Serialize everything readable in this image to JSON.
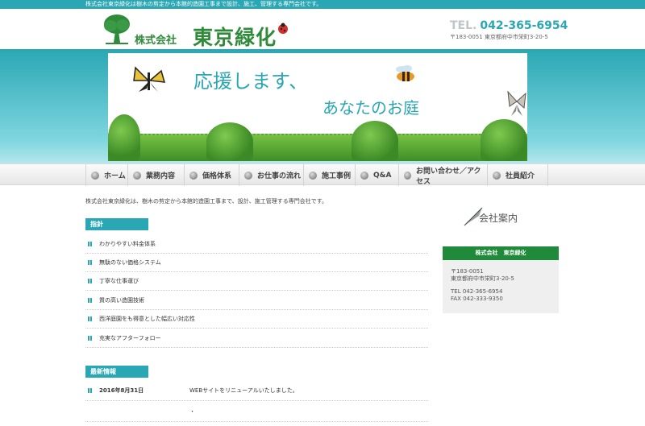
{
  "topbar": {
    "text": "株式会社東京緑化は樹木の剪定から本館的造園工事まで設計、施工、管理する専門会社です。"
  },
  "header": {
    "logo_small": "株式会社",
    "logo_big": "東京緑化",
    "tel_label": "TEL.",
    "tel": "042-365-6954",
    "address": "〒183-0051 東京都府中市栄町3-20-5"
  },
  "banner": {
    "line1": "応援します、",
    "line2": "あなたのお庭"
  },
  "nav": {
    "items": [
      {
        "label": "ホーム"
      },
      {
        "label": "業務内容"
      },
      {
        "label": "価格体系"
      },
      {
        "label": "お仕事の流れ"
      },
      {
        "label": "施工事例"
      },
      {
        "label": "Q&A"
      },
      {
        "label": "お問い合わせ／アクセス"
      },
      {
        "label": "社員紹介"
      }
    ]
  },
  "intro": "株式会社東京緑化は、樹木の剪定から本館的造園工事まで、設計、施工管理する専門会社です。",
  "policy": {
    "title": "指針",
    "items": [
      "わかりやすい料金体系",
      "無駄のない価格システム",
      "丁寧な仕事運び",
      "質の高い造園技術",
      "西洋庭園をも得意とした幅広い対応性",
      "充実なアフターフォロー"
    ]
  },
  "news": {
    "title": "最新情報",
    "items": [
      {
        "date": "2016年8月31日",
        "text": "WEBサイトをリニューアルいたしました。"
      },
      {
        "date": "",
        "text": "・"
      }
    ]
  },
  "company": {
    "heading": "会社案内",
    "box_title": "株式会社　東京緑化",
    "zip": "〒183-0051",
    "address": "東京都府中市栄町3-20-5",
    "tel": "TEL 042-365-6954",
    "fax": "FAX 042-333-9350"
  },
  "colors": {
    "accent": "#2aa7b4",
    "brand_green": "#1f8a3a"
  }
}
